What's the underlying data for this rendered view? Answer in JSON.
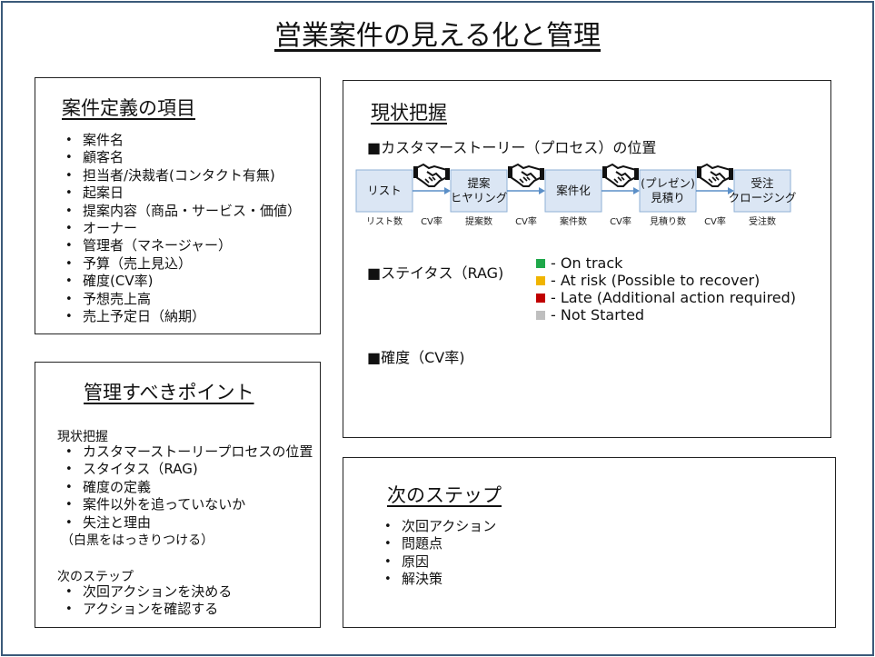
{
  "title": "営業案件の見える化と管理",
  "definition": {
    "heading": "案件定義の項目",
    "items": [
      "案件名",
      "顧客名",
      "担当者/決裁者(コンタクト有無)",
      "起案日",
      "提案内容（商品・サービス・価値）",
      "オーナー",
      "管理者（マネージャー）",
      "予算（売上見込）",
      "確度(CV率)",
      "予想売上高",
      "売上予定日（納期）"
    ]
  },
  "points": {
    "heading": "管理すべきポイント",
    "current_label": "現状把握",
    "current_items": [
      "カスタマーストーリープロセスの位置",
      "スタイタス（RAG)",
      "確度の定義",
      "案件以外を追っていないか",
      "失注と理由"
    ],
    "current_note": "（白黒をはっきりつける）",
    "next_label": "次のステップ",
    "next_items": [
      "次回アクションを決める",
      "アクションを確認する"
    ]
  },
  "status": {
    "heading": "現状把握",
    "process_label": "■カスタマーストーリー（プロセス）の位置",
    "stages": [
      {
        "lines": [
          "リスト"
        ],
        "below": "リスト数"
      },
      {
        "lines": [
          "提案",
          "ヒヤリング"
        ],
        "below": "提案数"
      },
      {
        "lines": [
          "案件化"
        ],
        "below": "案件数"
      },
      {
        "lines": [
          "(プレゼン)",
          "見積り"
        ],
        "below": "見積り数"
      },
      {
        "lines": [
          "受注",
          "クロージング"
        ],
        "below": "受注数"
      }
    ],
    "arrow_label": "CV率",
    "rag_label": "■ステイタス（RAG)",
    "rag_items": [
      {
        "color": "#1fa84a",
        "text": "- On track"
      },
      {
        "color": "#f0b400",
        "text": "- At risk (Possible to recover)"
      },
      {
        "color": "#c00000",
        "text": "- Late (Additional action required)"
      },
      {
        "color": "#bfbfbf",
        "text": "- Not Started"
      }
    ],
    "cv_label": "■確度（CV率)"
  },
  "next": {
    "heading": "次のステップ",
    "items": [
      "次回アクション",
      "問題点",
      "原因",
      "解決策"
    ]
  },
  "chart_data": {
    "type": "table",
    "stages": [
      "リスト",
      "提案 ヒヤリング",
      "案件化",
      "(プレゼン) 見積り",
      "受注 クロージング"
    ],
    "stage_counts": [
      "リスト数",
      "提案数",
      "案件数",
      "見積り数",
      "受注数"
    ],
    "transition_label": "CV率",
    "rag_legend": [
      "On track",
      "At risk (Possible to recover)",
      "Late (Additional action required)",
      "Not Started"
    ]
  }
}
